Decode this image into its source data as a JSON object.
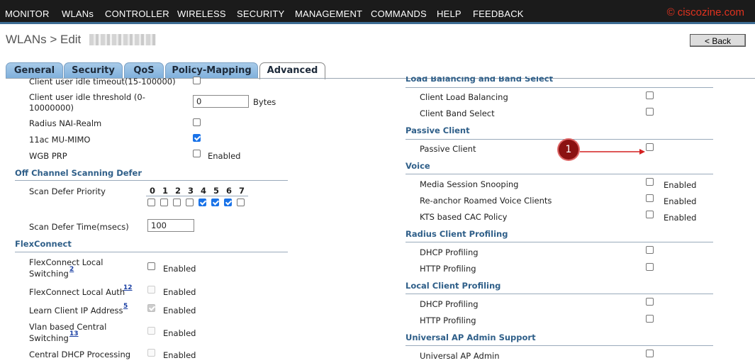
{
  "menu": {
    "items": [
      "MONITOR",
      "WLANs",
      "CONTROLLER",
      "WIRELESS",
      "SECURITY",
      "MANAGEMENT",
      "COMMANDS",
      "HELP",
      "FEEDBACK"
    ],
    "watermark": "© ciscozine.com"
  },
  "header": {
    "title": "WLANs > Edit",
    "back_label": "< Back"
  },
  "tabs": [
    "General",
    "Security",
    "QoS",
    "Policy-Mapping",
    "Advanced"
  ],
  "left": {
    "idle_timeout_label": "Client user idle timeout(15-100000)",
    "idle_threshold_label": "Client user idle threshold (0-",
    "idle_threshold_label2": "10000000)",
    "idle_threshold_value": "0",
    "idle_threshold_unit": "Bytes",
    "radius_nai_label": "Radius NAI-Realm",
    "mu_mimo_label": "11ac MU-MIMO",
    "wgb_prp_label": "WGB PRP",
    "wgb_prp_enabled": "Enabled",
    "offchannel_title": "Off Channel Scanning Defer",
    "scan_priority_label": "Scan Defer Priority",
    "priorities": [
      "0",
      "1",
      "2",
      "3",
      "4",
      "5",
      "6",
      "7"
    ],
    "scan_time_label": "Scan Defer Time(msecs)",
    "scan_time_value": "100",
    "flex_title": "FlexConnect",
    "flex_local_switching_1": "FlexConnect Local",
    "flex_local_switching_2": "Switching",
    "flex_local_switching_sup": "2",
    "flex_local_auth": "FlexConnect Local Auth",
    "flex_local_auth_sup": "12",
    "learn_ip": "Learn Client IP Address",
    "learn_ip_sup": "5",
    "vlan_central_1": "Vlan based Central",
    "vlan_central_2": "Switching",
    "vlan_central_sup": "13",
    "central_dhcp": "Central DHCP Processing",
    "enabled": "Enabled"
  },
  "right": {
    "lb_title": "Load Balancing and Band Select",
    "client_lb": "Client Load Balancing",
    "client_band": "Client Band Select",
    "passive_title": "Passive Client",
    "passive_client": "Passive Client",
    "voice_title": "Voice",
    "media_snooping": "Media Session Snooping",
    "reanchor": "Re-anchor Roamed Voice Clients",
    "kts": "KTS based CAC Policy",
    "radius_prof_title": "Radius Client Profiling",
    "dhcp_prof": "DHCP Profiling",
    "http_prof": "HTTP Profiling",
    "local_prof_title": "Local Client Profiling",
    "uap_title": "Universal AP Admin Support",
    "uap_admin": "Universal AP Admin",
    "enabled": "Enabled"
  },
  "annotation": {
    "marker": "1"
  }
}
